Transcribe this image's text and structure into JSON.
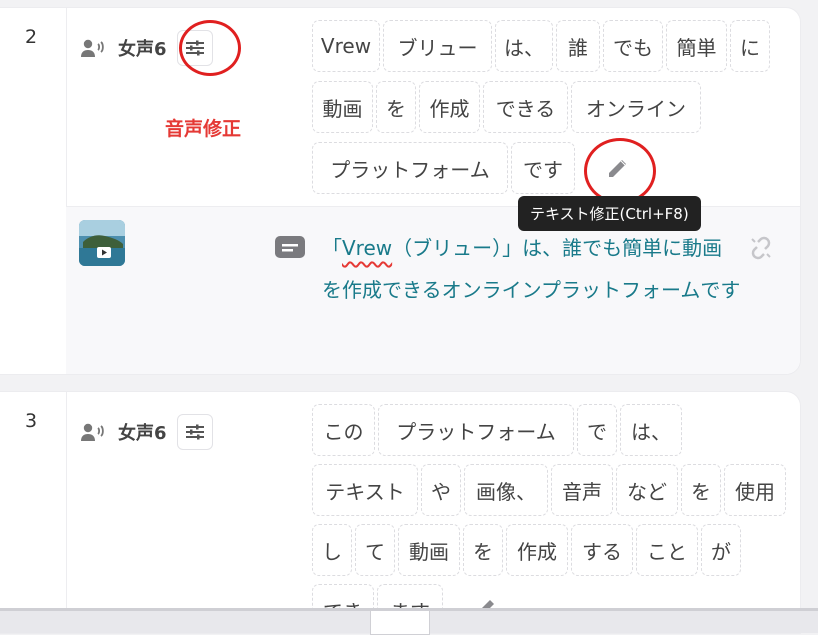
{
  "clip1": {
    "number": "2",
    "speaker": "女声6",
    "annotation": "音声修正",
    "words": [
      "Vrew",
      "ブリュー",
      "は、",
      "誰",
      "でも",
      "簡単",
      "に",
      "動画",
      "を",
      "作成",
      "できる",
      "オンライン",
      "プラットフォーム",
      "です"
    ],
    "tooltip": "テキスト修正(Ctrl+F8)",
    "subtitle_pre": "「",
    "subtitle_u": "Vrew",
    "subtitle_post": "（ブリュー）」は、誰でも簡単に動画を作成できるオンラインプラットフォームです"
  },
  "clip2": {
    "number": "3",
    "speaker": "女声6",
    "words": [
      "この",
      "プラットフォーム",
      "で",
      "は、",
      "テキスト",
      "や",
      "画像、",
      "音声",
      "など",
      "を",
      "使用",
      "し",
      "て",
      "動画",
      "を",
      "作成",
      "する",
      "こと",
      "が",
      "でき",
      "ます"
    ]
  },
  "colors": {
    "accent_red": "#e53935",
    "subtitle": "#197a8a"
  }
}
